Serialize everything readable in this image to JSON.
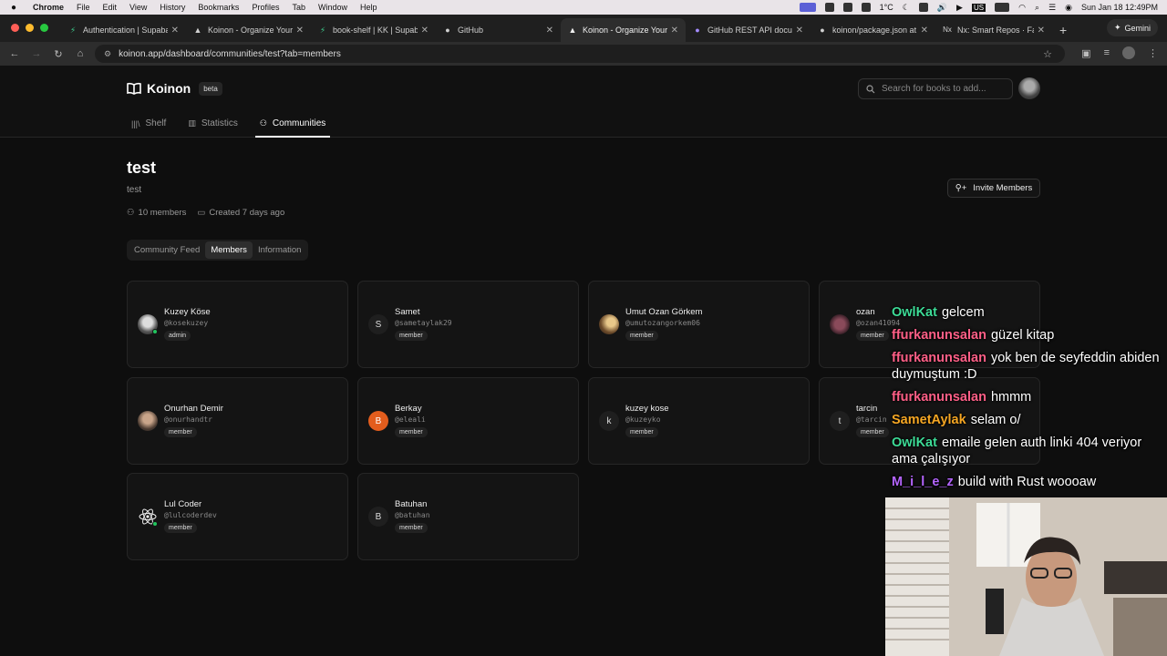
{
  "menubar": {
    "app": "Chrome",
    "items": [
      "File",
      "Edit",
      "View",
      "History",
      "Bookmarks",
      "Profiles",
      "Tab",
      "Window",
      "Help"
    ],
    "weather": "1°C",
    "locale": "US",
    "datetime": "Sun Jan 18  12:49PM"
  },
  "tabs": [
    {
      "title": "Authentication | Supaba",
      "icon": "supabase-icon"
    },
    {
      "title": "Koinon - Organize Your",
      "icon": "vercel-icon"
    },
    {
      "title": "book-shelf | KK | Supab",
      "icon": "supabase-icon"
    },
    {
      "title": "GitHub",
      "icon": "github-icon"
    },
    {
      "title": "Koinon - Organize Your",
      "icon": "vercel-icon",
      "active": true
    },
    {
      "title": "GitHub REST API docum",
      "icon": "github-docs-icon"
    },
    {
      "title": "koinon/package.json at",
      "icon": "github-icon"
    },
    {
      "title": "Nx: Smart Repos · Fast",
      "icon": "nx-icon"
    }
  ],
  "gemini_label": "Gemini",
  "url": "koinon.app/dashboard/communities/test?tab=members",
  "app": {
    "brand": "Koinon",
    "badge": "beta",
    "search_placeholder": "Search for books to add...",
    "nav": [
      {
        "label": "Shelf",
        "icon": "shelf-icon"
      },
      {
        "label": "Statistics",
        "icon": "chart-icon"
      },
      {
        "label": "Communities",
        "icon": "users-icon",
        "active": true
      }
    ]
  },
  "community": {
    "name": "test",
    "description": "test",
    "members_count": "10 members",
    "created": "Created 7 days ago",
    "invite_label": "Invite Members",
    "tabs": [
      "Community Feed",
      "Members",
      "Information"
    ]
  },
  "members": [
    {
      "name": "Kuzey Köse",
      "handle": "@kosekuzey",
      "role": "admin",
      "avatar": "photo",
      "online": true
    },
    {
      "name": "Samet",
      "handle": "@sametaylak29",
      "role": "member",
      "avatar": "S"
    },
    {
      "name": "Umut Ozan Görkem",
      "handle": "@umutozangorkem06",
      "role": "member",
      "avatar": "photo"
    },
    {
      "name": "ozan",
      "handle": "@ozan41094",
      "role": "member",
      "avatar": "photo"
    },
    {
      "name": "Onurhan Demir",
      "handle": "@onurhandtr",
      "role": "member",
      "avatar": "photo"
    },
    {
      "name": "Berkay",
      "handle": "@eleali",
      "role": "member",
      "avatar": "B"
    },
    {
      "name": "kuzey kose",
      "handle": "@kuzeyko",
      "role": "member",
      "avatar": "k"
    },
    {
      "name": "tarcin",
      "handle": "@tarcin",
      "role": "member",
      "avatar": "t"
    },
    {
      "name": "Lul Coder",
      "handle": "@lulcoderdev",
      "role": "member",
      "avatar": "react-logo",
      "online": true
    },
    {
      "name": "Batuhan",
      "handle": "@batuhan",
      "role": "member",
      "avatar": "B"
    }
  ],
  "chat": [
    {
      "user": "OwlKat",
      "color": "#3ddc97",
      "text": "gelcem"
    },
    {
      "user": "ffurkanunsalan",
      "color": "#ff5f87",
      "text": "güzel kitap"
    },
    {
      "user": "ffurkanunsalan",
      "color": "#ff5f87",
      "text": "yok ben de seyfeddin abiden duymuştum :D"
    },
    {
      "user": "ffurkanunsalan",
      "color": "#ff5f87",
      "text": "hmmm"
    },
    {
      "user": "SametAylak",
      "color": "#f5a623",
      "text": "selam o/"
    },
    {
      "user": "OwlKat",
      "color": "#3ddc97",
      "text": "emaile gelen auth linki 404 veriyor ama çalışıyor"
    },
    {
      "user": "M_i_l_e_z",
      "color": "#b565ff",
      "text": "build with Rust woooaw"
    }
  ]
}
